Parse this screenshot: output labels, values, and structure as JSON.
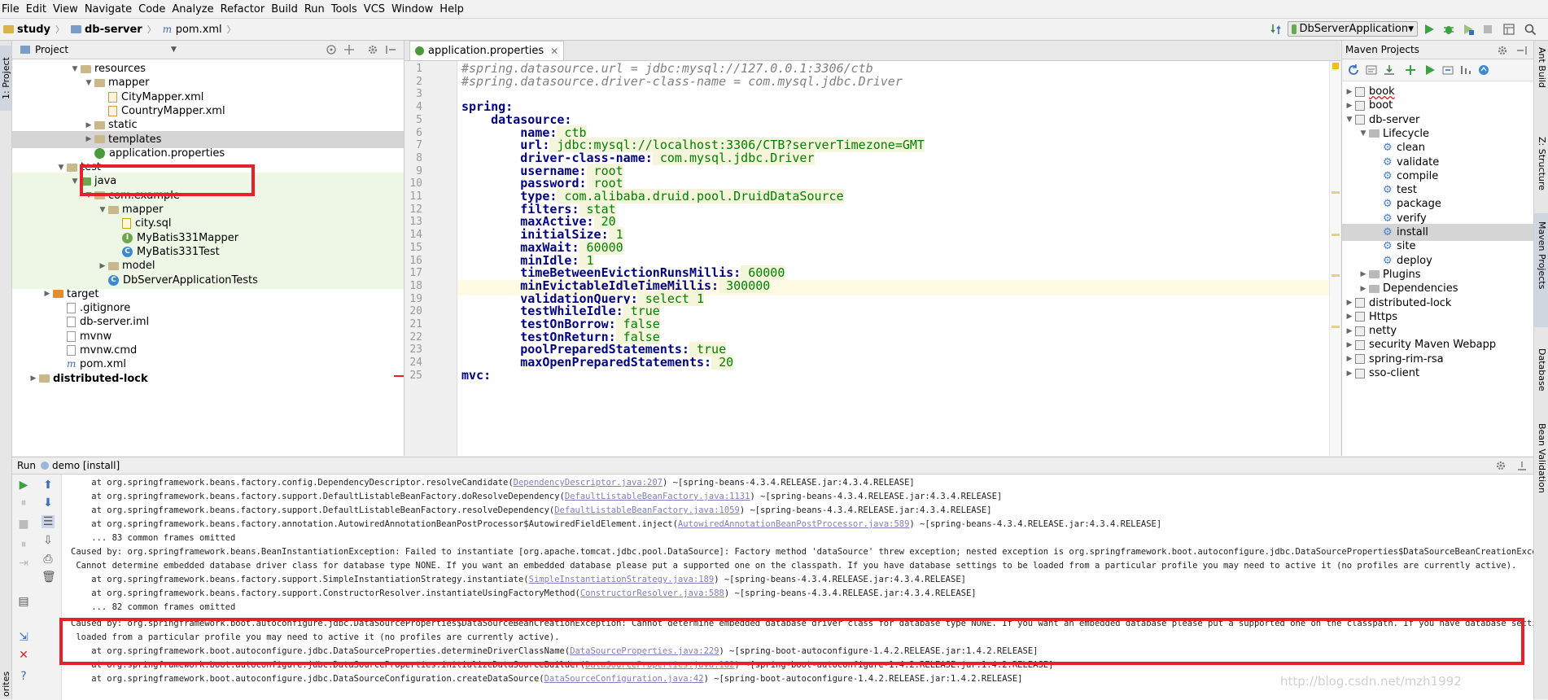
{
  "menu": [
    "File",
    "Edit",
    "View",
    "Navigate",
    "Code",
    "Analyze",
    "Refactor",
    "Build",
    "Run",
    "Tools",
    "VCS",
    "Window",
    "Help"
  ],
  "breadcrumb": {
    "project": "study",
    "module": "db-server",
    "file": "pom.xml"
  },
  "run_config": "DbServerApplication",
  "left_strip": {
    "project_tab": "1: Project",
    "favorites_tab": "orites"
  },
  "project_panel": {
    "title": "Project",
    "tree": [
      {
        "label": "resources",
        "depth": 4,
        "icon": "folder",
        "arrow": "down"
      },
      {
        "label": "mapper",
        "depth": 5,
        "icon": "folder",
        "arrow": "down"
      },
      {
        "label": "CityMapper.xml",
        "depth": 6,
        "icon": "xml"
      },
      {
        "label": "CountryMapper.xml",
        "depth": 6,
        "icon": "xml"
      },
      {
        "label": "static",
        "depth": 5,
        "icon": "folder",
        "arrow": "right"
      },
      {
        "label": "templates",
        "depth": 5,
        "icon": "folder",
        "arrow": "right"
      },
      {
        "label": "application.properties",
        "depth": 5,
        "icon": "leaf"
      },
      {
        "label": "test",
        "depth": 3,
        "icon": "folder",
        "arrow": "down"
      },
      {
        "label": "java",
        "depth": 4,
        "icon": "folder-green",
        "arrow": "down"
      },
      {
        "label": "com.example",
        "depth": 5,
        "icon": "folder",
        "arrow": "down"
      },
      {
        "label": "mapper",
        "depth": 6,
        "icon": "folder",
        "arrow": "down"
      },
      {
        "label": "city.sql",
        "depth": 7,
        "icon": "sql"
      },
      {
        "label": "MyBatis331Mapper",
        "depth": 7,
        "icon": "interface"
      },
      {
        "label": "MyBatis331Test",
        "depth": 7,
        "icon": "class"
      },
      {
        "label": "model",
        "depth": 6,
        "icon": "folder",
        "arrow": "right"
      },
      {
        "label": "DbServerApplicationTests",
        "depth": 6,
        "icon": "class"
      },
      {
        "label": "target",
        "depth": 2,
        "icon": "folder-orange",
        "arrow": "right"
      },
      {
        "label": ".gitignore",
        "depth": 3,
        "icon": "file"
      },
      {
        "label": "db-server.iml",
        "depth": 3,
        "icon": "file"
      },
      {
        "label": "mvnw",
        "depth": 3,
        "icon": "file"
      },
      {
        "label": "mvnw.cmd",
        "depth": 3,
        "icon": "file"
      },
      {
        "label": "pom.xml",
        "depth": 3,
        "icon": "maven"
      },
      {
        "label": "distributed-lock",
        "depth": 1,
        "icon": "folder",
        "arrow": "right",
        "bold": true
      }
    ]
  },
  "editor": {
    "tab": "application.properties",
    "lines": [
      [
        {
          "t": "#spring.datasource.url = jdbc:mysql://127.0.0.1:3306/ctb",
          "c": "com"
        }
      ],
      [
        {
          "t": "#spring.datasource.driver-class-name = com.mysql.jdbc.Driver",
          "c": "com"
        }
      ],
      [],
      [
        {
          "t": "spring:",
          "c": "key"
        }
      ],
      [
        {
          "t": "    "
        },
        {
          "t": "datasource:",
          "c": "key"
        }
      ],
      [
        {
          "t": "        "
        },
        {
          "t": "name:",
          "c": "key"
        },
        {
          "t": " ctb",
          "c": "val"
        }
      ],
      [
        {
          "t": "        "
        },
        {
          "t": "url:",
          "c": "key"
        },
        {
          "t": " jdbc:mysql://localhost:3306/CTB?serverTimezone=GMT",
          "c": "val"
        }
      ],
      [
        {
          "t": "        "
        },
        {
          "t": "driver-class-name:",
          "c": "key"
        },
        {
          "t": " com.mysql.jdbc.Driver",
          "c": "val"
        }
      ],
      [
        {
          "t": "        "
        },
        {
          "t": "username:",
          "c": "key"
        },
        {
          "t": " root",
          "c": "val"
        }
      ],
      [
        {
          "t": "        "
        },
        {
          "t": "password:",
          "c": "key"
        },
        {
          "t": " root",
          "c": "val"
        }
      ],
      [
        {
          "t": "        "
        },
        {
          "t": "type:",
          "c": "key"
        },
        {
          "t": " com.alibaba.druid.pool.DruidDataSource",
          "c": "val"
        }
      ],
      [
        {
          "t": "        "
        },
        {
          "t": "filters:",
          "c": "key"
        },
        {
          "t": " stat",
          "c": "val"
        }
      ],
      [
        {
          "t": "        "
        },
        {
          "t": "maxActive:",
          "c": "key"
        },
        {
          "t": " 20",
          "c": "val"
        }
      ],
      [
        {
          "t": "        "
        },
        {
          "t": "initialSize:",
          "c": "key"
        },
        {
          "t": " 1",
          "c": "val"
        }
      ],
      [
        {
          "t": "        "
        },
        {
          "t": "maxWait:",
          "c": "key"
        },
        {
          "t": " 60000",
          "c": "val"
        }
      ],
      [
        {
          "t": "        "
        },
        {
          "t": "minIdle:",
          "c": "key"
        },
        {
          "t": " 1",
          "c": "val"
        }
      ],
      [
        {
          "t": "        "
        },
        {
          "t": "timeBetweenEvictionRunsMillis:",
          "c": "key"
        },
        {
          "t": " 60000",
          "c": "val"
        }
      ],
      [
        {
          "t": "        "
        },
        {
          "t": "minEvictableIdleTimeMillis:",
          "c": "key"
        },
        {
          "t": " 300000",
          "c": "val"
        }
      ],
      [
        {
          "t": "        "
        },
        {
          "t": "validationQuery:",
          "c": "key"
        },
        {
          "t": " select 1",
          "c": "val"
        }
      ],
      [
        {
          "t": "        "
        },
        {
          "t": "testWhileIdle:",
          "c": "key"
        },
        {
          "t": " true",
          "c": "val"
        }
      ],
      [
        {
          "t": "        "
        },
        {
          "t": "testOnBorrow:",
          "c": "key"
        },
        {
          "t": " false",
          "c": "val"
        }
      ],
      [
        {
          "t": "        "
        },
        {
          "t": "testOnReturn:",
          "c": "key"
        },
        {
          "t": " false",
          "c": "val"
        }
      ],
      [
        {
          "t": "        "
        },
        {
          "t": "poolPreparedStatements:",
          "c": "key"
        },
        {
          "t": " true",
          "c": "val"
        }
      ],
      [
        {
          "t": "        "
        },
        {
          "t": "maxOpenPreparedStatements:",
          "c": "key"
        },
        {
          "t": " 20",
          "c": "val"
        }
      ],
      [
        {
          "t": "mvc:",
          "c": "key"
        }
      ]
    ]
  },
  "maven_panel": {
    "title": "Maven Projects",
    "tree": [
      {
        "label": "book",
        "depth": 0,
        "icon": "mvn",
        "arrow": "right",
        "underline": true
      },
      {
        "label": "boot",
        "depth": 0,
        "icon": "mvn",
        "arrow": "right"
      },
      {
        "label": "db-server",
        "depth": 0,
        "icon": "mvn",
        "arrow": "down"
      },
      {
        "label": "Lifecycle",
        "depth": 1,
        "icon": "folder",
        "arrow": "down"
      },
      {
        "label": "clean",
        "depth": 2,
        "icon": "gear"
      },
      {
        "label": "validate",
        "depth": 2,
        "icon": "gear"
      },
      {
        "label": "compile",
        "depth": 2,
        "icon": "gear"
      },
      {
        "label": "test",
        "depth": 2,
        "icon": "gear"
      },
      {
        "label": "package",
        "depth": 2,
        "icon": "gear"
      },
      {
        "label": "verify",
        "depth": 2,
        "icon": "gear"
      },
      {
        "label": "install",
        "depth": 2,
        "icon": "gear",
        "selected": true
      },
      {
        "label": "site",
        "depth": 2,
        "icon": "gear"
      },
      {
        "label": "deploy",
        "depth": 2,
        "icon": "gear"
      },
      {
        "label": "Plugins",
        "depth": 1,
        "icon": "folder",
        "arrow": "right"
      },
      {
        "label": "Dependencies",
        "depth": 1,
        "icon": "folder",
        "arrow": "right"
      },
      {
        "label": "distributed-lock",
        "depth": 0,
        "icon": "mvn",
        "arrow": "right"
      },
      {
        "label": "Https",
        "depth": 0,
        "icon": "mvn",
        "arrow": "right"
      },
      {
        "label": "netty",
        "depth": 0,
        "icon": "mvn",
        "arrow": "right"
      },
      {
        "label": "security Maven Webapp",
        "depth": 0,
        "icon": "mvn",
        "arrow": "right"
      },
      {
        "label": "spring-rim-rsa",
        "depth": 0,
        "icon": "mvn",
        "arrow": "right"
      },
      {
        "label": "sso-client",
        "depth": 0,
        "icon": "mvn",
        "arrow": "right"
      }
    ]
  },
  "right_strip": [
    "Ant Build",
    "Z: Structure",
    "Maven Projects",
    "Database",
    "Bean Validation"
  ],
  "run_panel": {
    "label": "Run",
    "config": "demo [install]",
    "log": [
      [
        {
          "t": "    at org.springframework.beans.factory.config.DependencyDescriptor.resolveCandidate("
        },
        {
          "t": "DependencyDescriptor.java:207",
          "l": 1
        },
        {
          "t": ") ~[spring-beans-4.3.4.RELEASE.jar:4.3.4.RELEASE]"
        }
      ],
      [
        {
          "t": "    at org.springframework.beans.factory.support.DefaultListableBeanFactory.doResolveDependency("
        },
        {
          "t": "DefaultListableBeanFactory.java:1131",
          "l": 1
        },
        {
          "t": ") ~[spring-beans-4.3.4.RELEASE.jar:4.3.4.RELEASE]"
        }
      ],
      [
        {
          "t": "    at org.springframework.beans.factory.support.DefaultListableBeanFactory.resolveDependency("
        },
        {
          "t": "DefaultListableBeanFactory.java:1059",
          "l": 1
        },
        {
          "t": ") ~[spring-beans-4.3.4.RELEASE.jar:4.3.4.RELEASE]"
        }
      ],
      [
        {
          "t": "    at org.springframework.beans.factory.annotation.AutowiredAnnotationBeanPostProcessor$AutowiredFieldElement.inject("
        },
        {
          "t": "AutowiredAnnotationBeanPostProcessor.java:589",
          "l": 1
        },
        {
          "t": ") ~[spring-beans-4.3.4.RELEASE.jar:4.3.4.RELEASE]"
        }
      ],
      [
        {
          "t": "    ... 83 common frames omitted"
        }
      ],
      [
        {
          "t": "Caused by: org.springframework.beans.BeanInstantiationException: Failed to instantiate [org.apache.tomcat.jdbc.pool.DataSource]: Factory method 'dataSource' threw exception; nested exception is org.springframework.boot.autoconfigure.jdbc.DataSourceProperties$DataSourceBeanCreationException:"
        }
      ],
      [
        {
          "t": " Cannot determine embedded database driver class for database type NONE. If you want an embedded database please put a supported one on the classpath. If you have database settings to be loaded from a particular profile you may need to active it (no profiles are currently active)."
        }
      ],
      [
        {
          "t": "    at org.springframework.beans.factory.support.SimpleInstantiationStrategy.instantiate("
        },
        {
          "t": "SimpleInstantiationStrategy.java:189",
          "l": 1
        },
        {
          "t": ") ~[spring-beans-4.3.4.RELEASE.jar:4.3.4.RELEASE]"
        }
      ],
      [
        {
          "t": "    at org.springframework.beans.factory.support.ConstructorResolver.instantiateUsingFactoryMethod("
        },
        {
          "t": "ConstructorResolver.java:588",
          "l": 1
        },
        {
          "t": ") ~[spring-beans-4.3.4.RELEASE.jar:4.3.4.RELEASE]"
        }
      ],
      [
        {
          "t": "    ... 82 common frames omitted"
        }
      ],
      [
        {
          "t": "Caused by: org.springframework.boot.autoconfigure.jdbc.DataSourceProperties$DataSourceBeanCreationException: Cannot determine embedded database driver class for database type NONE. If you want an embedded database please put a supported one on the classpath. If you have database settings to be"
        }
      ],
      [
        {
          "t": " loaded from a particular profile you may need to active it (no profiles are currently active)."
        }
      ],
      [
        {
          "t": "    at org.springframework.boot.autoconfigure.jdbc.DataSourceProperties.determineDriverClassName("
        },
        {
          "t": "DataSourceProperties.java:229",
          "l": 1
        },
        {
          "t": ") ~[spring-boot-autoconfigure-1.4.2.RELEASE.jar:1.4.2.RELEASE]"
        }
      ],
      [
        {
          "t": "    at org.springframework.boot.autoconfigure.jdbc.DataSourceProperties.initializeDataSourceBuilder("
        },
        {
          "t": "DataSourceProperties.java:182",
          "l": 1
        },
        {
          "t": ") ~[spring-boot-autoconfigure-1.4.2.RELEASE.jar:1.4.2.RELEASE]"
        }
      ],
      [
        {
          "t": "    at org.springframework.boot.autoconfigure.jdbc.DataSourceConfiguration.createDataSource("
        },
        {
          "t": "DataSourceConfiguration.java:42",
          "l": 1
        },
        {
          "t": ") ~[spring-boot-autoconfigure-1.4.2.RELEASE.jar:1.4.2.RELEASE]"
        }
      ]
    ]
  },
  "watermark": "http://blog.csdn.net/mzh1992",
  "colors": {
    "highlight_red": "#e8202a",
    "key": "#000080",
    "value": "#008000",
    "comment": "#808080"
  }
}
